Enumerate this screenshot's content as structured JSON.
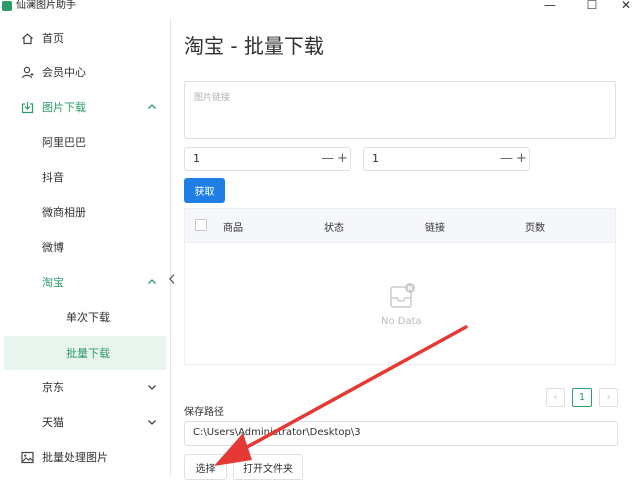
{
  "window": {
    "title": "仙澜图片助手",
    "minimize": "—",
    "maximize": "☐",
    "close": "✕"
  },
  "sidebar": {
    "items": [
      {
        "label": "首页",
        "icon": "home-icon"
      },
      {
        "label": "会员中心",
        "icon": "user-icon"
      },
      {
        "label": "图片下载",
        "icon": "download-icon"
      },
      {
        "label": "阿里巴巴"
      },
      {
        "label": "抖音"
      },
      {
        "label": "微商相册"
      },
      {
        "label": "微博"
      },
      {
        "label": "淘宝"
      },
      {
        "label": "单次下载"
      },
      {
        "label": "批量下载"
      },
      {
        "label": "京东"
      },
      {
        "label": "天猫"
      },
      {
        "label": "批量处理图片",
        "icon": "image-icon"
      }
    ]
  },
  "main": {
    "title": "淘宝 - 批量下载",
    "link_placeholder": "图片链接",
    "stepper1": {
      "value": "1",
      "minus": "—",
      "plus": "+"
    },
    "stepper2": {
      "value": "1",
      "minus": "—",
      "plus": "+"
    },
    "fetch_button": "获取",
    "table": {
      "columns": [
        "商品",
        "状态",
        "链接",
        "页数"
      ],
      "empty_text": "No Data"
    },
    "pagination": {
      "prev": "‹",
      "current": "1",
      "next": "›"
    },
    "save_path_label": "保存路径",
    "save_path_value": "C:\\Users\\Administrator\\Desktop\\3",
    "select_button": "选择",
    "open_folder_button": "打开文件夹"
  },
  "colors": {
    "accent": "#2e9b6a",
    "primary_button": "#1f7fe6",
    "annotation_arrow": "#e53935"
  }
}
